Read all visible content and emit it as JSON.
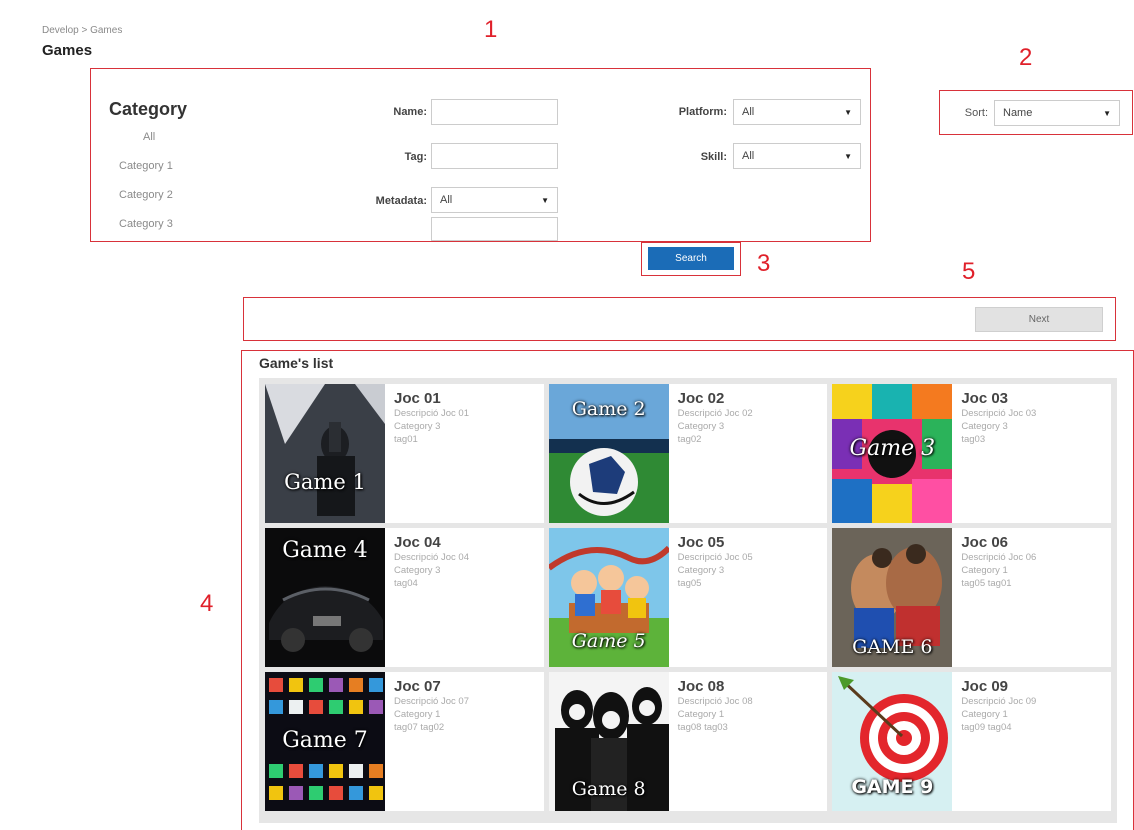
{
  "breadcrumb": "Develop > Games",
  "page_title": "Games",
  "annotations": [
    "1",
    "2",
    "3",
    "4",
    "5"
  ],
  "filters": {
    "category_title": "Category",
    "categories": [
      "All",
      "Category 1",
      "Category 2",
      "Category 3"
    ],
    "name_label": "Name:",
    "name_value": "",
    "tag_label": "Tag:",
    "tag_value": "",
    "metadata_label": "Metadata:",
    "metadata_value": "All",
    "metadata_extra_value": "",
    "platform_label": "Platform:",
    "platform_value": "All",
    "skill_label": "Skill:",
    "skill_value": "All"
  },
  "sort": {
    "label": "Sort:",
    "value": "Name"
  },
  "search_button": "Search",
  "next_button": "Next",
  "list_title": "Game's list",
  "games": [
    {
      "title": "Joc 01",
      "desc": "Descripció Joc 01",
      "category": "Category 3",
      "tags": "tag01",
      "thumb_label": "Game 1"
    },
    {
      "title": "Joc 02",
      "desc": "Descripció Joc 02",
      "category": "Category 3",
      "tags": "tag02",
      "thumb_label": "Game 2"
    },
    {
      "title": "Joc 03",
      "desc": "Descripció Joc 03",
      "category": "Category 3",
      "tags": "tag03",
      "thumb_label": "Game 3"
    },
    {
      "title": "Joc 04",
      "desc": "Descripció Joc 04",
      "category": "Category 3",
      "tags": "tag04",
      "thumb_label": "Game 4"
    },
    {
      "title": "Joc 05",
      "desc": "Descripció Joc 05",
      "category": "Category 3",
      "tags": "tag05",
      "thumb_label": "Game 5"
    },
    {
      "title": "Joc 06",
      "desc": "Descripció Joc 06",
      "category": "Category 1",
      "tags": "tag05 tag01",
      "thumb_label": "GAME 6"
    },
    {
      "title": "Joc 07",
      "desc": "Descripció Joc 07",
      "category": "Category 1",
      "tags": "tag07 tag02",
      "thumb_label": "Game 7"
    },
    {
      "title": "Joc 08",
      "desc": "Descripció Joc 08",
      "category": "Category 1",
      "tags": "tag08 tag03",
      "thumb_label": "Game 8"
    },
    {
      "title": "Joc 09",
      "desc": "Descripció Joc 09",
      "category": "Category 1",
      "tags": "tag09 tag04",
      "thumb_label": "GAME 9"
    }
  ],
  "colors": {
    "search_button": "#1b6cb7",
    "annotation": "#e0202a",
    "grid_bg": "#e6e6e6"
  }
}
